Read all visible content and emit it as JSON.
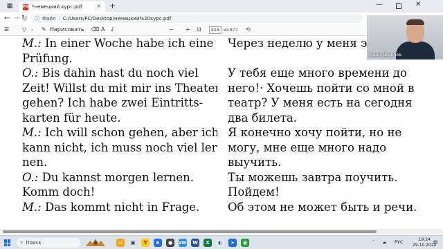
{
  "browser": {
    "tab_title": "*немецкий курс.pdf",
    "tab_close": "×",
    "new_tab": "+",
    "address_label": "Файл",
    "address_url": "C:/Users/PC/Desktop/немецкий%20курс.pdf",
    "nav_back": "←",
    "nav_forward": "→",
    "nav_reload": "↻"
  },
  "pdf_toolbar": {
    "draw_label": "Нарисовать",
    "zoom_out": "−",
    "zoom_in": "+",
    "page_current": "215",
    "page_total": "из 877"
  },
  "document": {
    "left_lines": [
      [
        "M.:",
        " In einer Woche habe ich eine"
      ],
      [
        "",
        "Prüfung."
      ],
      [
        "O.:",
        " Bis dahin hast du noch viel"
      ],
      [
        "",
        "Zeit! Willst du mit mir ins Theater"
      ],
      [
        "",
        "gehen? Ich habe zwei Eintritts-"
      ],
      [
        "",
        "karten für heute."
      ],
      [
        "M.:",
        " Ich will schon gehen, aber ich"
      ],
      [
        "",
        "kann nicht, ich muss noch viel ler-"
      ],
      [
        "",
        "nen."
      ],
      [
        "O.:",
        " Du kannst morgen lernen."
      ],
      [
        "",
        "Komm doch!"
      ],
      [
        "M.:",
        " Das kommt nicht in Frage."
      ]
    ],
    "right_lines": [
      "Через неделю у меня эк",
      "",
      "У тебя еще много времени до",
      "него!· Хочешь пойти со мной в",
      "театр? У меня есть на сегодня",
      "два билета.",
      "Я конечно хочу  пойти, но не",
      "могу,  мне  еще  много  надо",
      "выучить.",
      "Ты  можешь  завтра  поучить.",
      "Пойдем!",
      "Об этом не может быть и речи."
    ]
  },
  "webcam": {
    "name": "Иван Ширяев"
  },
  "taskbar": {
    "search_placeholder": "Поиск",
    "lang": "РУС",
    "time": "19:24",
    "date": "29.10.2024"
  }
}
